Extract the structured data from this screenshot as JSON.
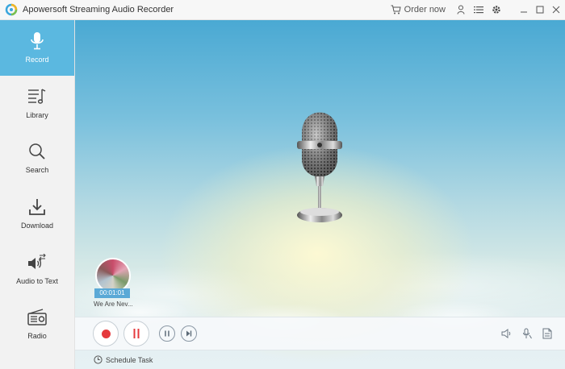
{
  "window": {
    "title": "Apowersoft Streaming Audio Recorder",
    "order_now": "Order now"
  },
  "sidebar": {
    "items": [
      {
        "label": "Record",
        "icon": "microphone-icon",
        "active": true
      },
      {
        "label": "Library",
        "icon": "music-list-icon",
        "active": false
      },
      {
        "label": "Search",
        "icon": "search-icon",
        "active": false
      },
      {
        "label": "Download",
        "icon": "download-icon",
        "active": false
      },
      {
        "label": "Audio to Text",
        "icon": "audio-to-text-icon",
        "active": false
      },
      {
        "label": "Radio",
        "icon": "radio-icon",
        "active": false
      }
    ]
  },
  "player": {
    "time": "00:01:01",
    "track_name": "We Are Nev..."
  },
  "bottom": {
    "schedule_task": "Schedule Task"
  },
  "colors": {
    "accent": "#5bb8e0",
    "record": "#e5393d",
    "pause": "#e5393d"
  }
}
